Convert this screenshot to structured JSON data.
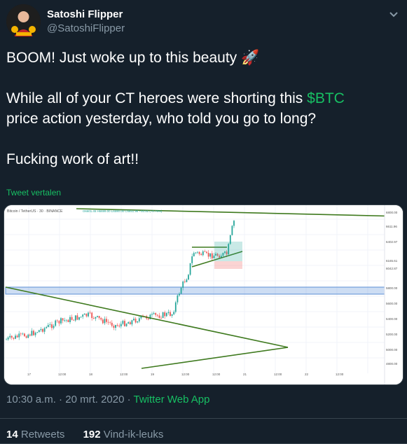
{
  "author": {
    "name": "Satoshi Flipper",
    "handle": "@SatoshiFlipper"
  },
  "tweet": {
    "line1": "BOOM! Just woke up to this beauty ",
    "rocket": "🚀",
    "line2_before": "While all of your CT heroes were shorting this ",
    "cashtag": "$BTC",
    "line2_after": " price action yesterday, who told you go to long?",
    "line3": "Fucking work of art!!",
    "translate": "Tweet vertalen"
  },
  "meta": {
    "time": "10:30 a.m.",
    "sep1": " · ",
    "date": "20 mrt. 2020",
    "sep2": " · ",
    "app": "Twitter Web App"
  },
  "stats": {
    "retweets": "14",
    "retweets_label": "Retweets",
    "likes": "192",
    "likes_label": "Vind-ik-leuks"
  },
  "chart_image": {
    "symbol": "Bitcoin / TetherUS · 30 · BINANCE",
    "ohlc": "O6601.45 H6699.00 L6590.00 C6651.96 +50.51 (+0.76%)",
    "y_ticks": [
      "6800.00",
      "6611.96",
      "6402.97",
      "6165.61",
      "6042.87",
      "5800.00",
      "5600.00",
      "5400.00",
      "5200.00",
      "5000.00",
      "4800.00"
    ],
    "x_ticks": [
      "17",
      "12:00",
      "18",
      "12:00",
      "19",
      "12:00",
      "12:00",
      "21",
      "12:00",
      "22",
      "12:00"
    ],
    "colors": {
      "up": "#26a69a",
      "down": "#ef5350",
      "trend": "#3f7a1f",
      "zone": "#5b8fd6"
    }
  }
}
